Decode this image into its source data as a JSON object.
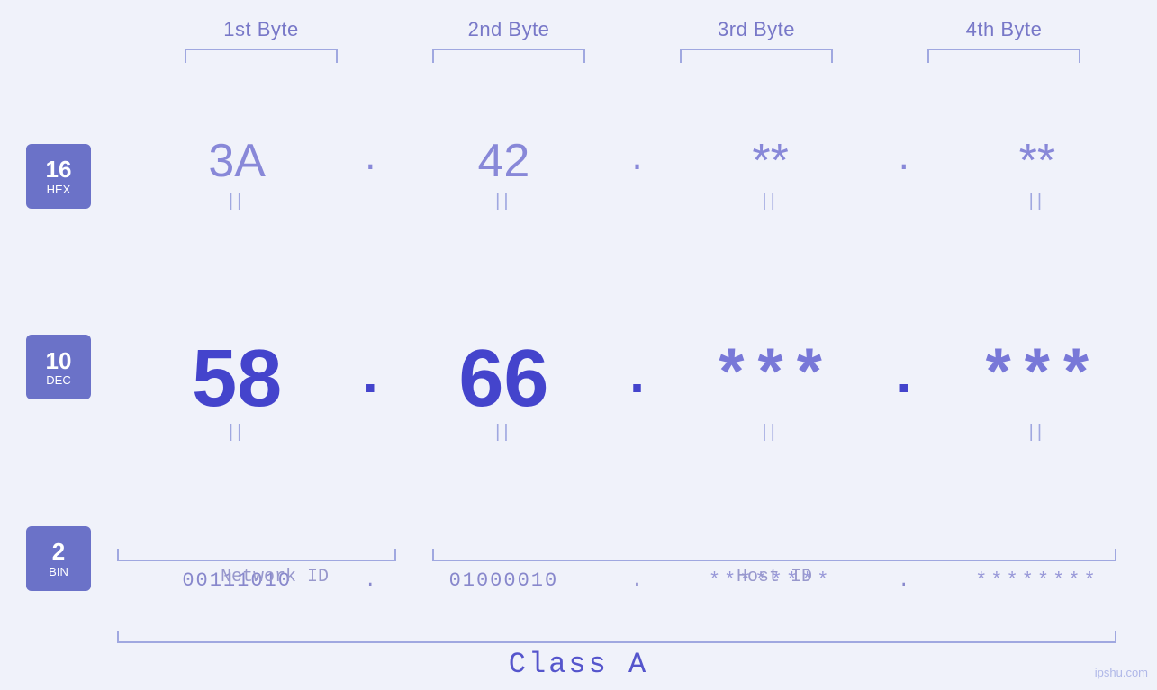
{
  "byteLabels": [
    "1st Byte",
    "2nd Byte",
    "3rd Byte",
    "4th Byte"
  ],
  "bases": [
    {
      "num": "16",
      "name": "HEX"
    },
    {
      "num": "10",
      "name": "DEC"
    },
    {
      "num": "2",
      "name": "BIN"
    }
  ],
  "hexRow": {
    "values": [
      "3A",
      "42",
      "**",
      "**"
    ],
    "dots": [
      ".",
      ".",
      ".",
      ""
    ]
  },
  "decRow": {
    "values": [
      "58",
      "66",
      "***",
      "***"
    ],
    "dots": [
      ".",
      ".",
      ".",
      ""
    ]
  },
  "binRow": {
    "values": [
      "00111010",
      "01000010",
      "********",
      "********"
    ],
    "dots": [
      ".",
      ".",
      ".",
      ""
    ]
  },
  "separator": "||",
  "labels": {
    "networkId": "Network ID",
    "hostId": "Host ID",
    "classA": "Class A"
  },
  "watermark": "ipshu.com"
}
